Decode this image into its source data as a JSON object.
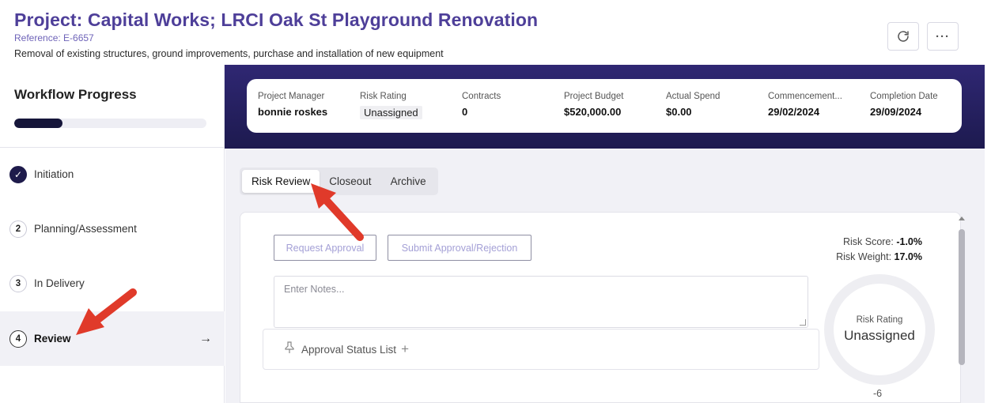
{
  "header": {
    "title": "Project: Capital Works; LRCI Oak St Playground Renovation",
    "reference": "Reference: E-6657",
    "description": "Removal of existing structures, ground improvements, purchase and installation of new equipment",
    "refresh_icon": "refresh-icon",
    "more_icon": "more-icon",
    "more_label": "···"
  },
  "workflow": {
    "title": "Workflow Progress",
    "progress_percent": 25,
    "steps": [
      {
        "num": "✓",
        "label": "Initiation",
        "state": "done"
      },
      {
        "num": "2",
        "label": "Planning/Assessment",
        "state": "pending"
      },
      {
        "num": "3",
        "label": "In Delivery",
        "state": "pending"
      },
      {
        "num": "4",
        "label": "Review",
        "state": "active"
      }
    ],
    "active_arrow": "→"
  },
  "summary": [
    {
      "label": "Project Manager",
      "value": "bonnie roskes"
    },
    {
      "label": "Risk Rating",
      "value": "Unassigned"
    },
    {
      "label": "Contracts",
      "value": "0"
    },
    {
      "label": "Project Budget",
      "value": "$520,000.00"
    },
    {
      "label": "Actual Spend",
      "value": "$0.00"
    },
    {
      "label": "Commencement...",
      "value": "29/02/2024"
    },
    {
      "label": "Completion Date",
      "value": "29/09/2024"
    }
  ],
  "tabs": [
    "Risk Review",
    "Closeout",
    "Archive"
  ],
  "risk_review": {
    "request_approval": "Request Approval",
    "submit_approval": "Submit Approval/Rejection",
    "notes_placeholder": "Enter Notes...",
    "approval_status": "Approval Status List",
    "approval_plus": "+",
    "risk_score_label": "Risk Score:",
    "risk_score_value": "-1.0%",
    "risk_weight_label": "Risk Weight:",
    "risk_weight_value": "17.0%",
    "gauge_label": "Risk Rating",
    "gauge_value": "Unassigned",
    "gauge_number": "-6"
  },
  "colors": {
    "brand_purple": "#4e3f99",
    "banner_dark": "#1d1a4f",
    "annotation_red": "#e03a2a"
  }
}
